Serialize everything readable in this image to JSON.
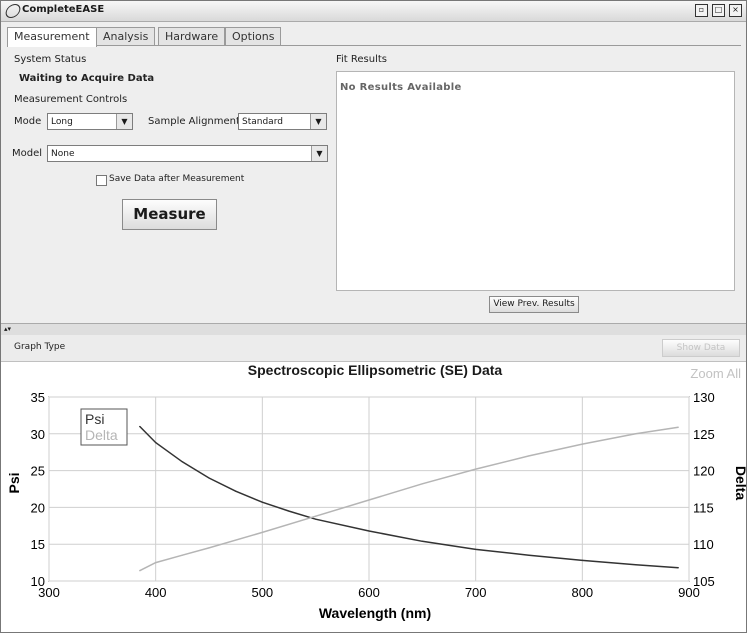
{
  "window": {
    "title": "CompleteEASE"
  },
  "tabs": [
    "Measurement",
    "Analysis",
    "Hardware",
    "Options"
  ],
  "system_status": {
    "heading": "System Status",
    "status": "Waiting to Acquire Data"
  },
  "controls": {
    "heading": "Measurement Controls",
    "mode_label": "Mode",
    "mode_value": "Long",
    "alignment_label": "Sample Alignment",
    "alignment_value": "Standard",
    "model_label": "Model",
    "model_value": "None",
    "save_label": "Save Data after Measurement",
    "measure_label": "Measure"
  },
  "fit_results": {
    "heading": "Fit Results",
    "empty": "No Results Available",
    "view_prev_label": "View Prev. Results"
  },
  "graph": {
    "type_label": "Graph Type",
    "show_data_label": "Show Data",
    "zoom_all_label": "Zoom All"
  },
  "chart_data": {
    "type": "line",
    "title": "Spectroscopic Ellipsometric (SE) Data",
    "xlabel": "Wavelength (nm)",
    "ylabel": "Psi",
    "ylabel_right": "Delta",
    "xlim": [
      300,
      900
    ],
    "ylim": [
      10,
      35
    ],
    "ylim_right": [
      105,
      130
    ],
    "xticks": [
      300,
      400,
      500,
      600,
      700,
      800,
      900
    ],
    "yticks": [
      10,
      15,
      20,
      25,
      30,
      35
    ],
    "yticks_right": [
      105,
      110,
      115,
      120,
      125,
      130
    ],
    "grid": true,
    "legend": "top-left",
    "series": [
      {
        "name": "Psi",
        "axis": "left",
        "color": "#333333",
        "x": [
          385,
          400,
          425,
          450,
          475,
          500,
          525,
          550,
          600,
          650,
          700,
          750,
          800,
          850,
          890
        ],
        "values": [
          31.0,
          28.8,
          26.2,
          24.0,
          22.2,
          20.7,
          19.5,
          18.4,
          16.8,
          15.4,
          14.3,
          13.5,
          12.8,
          12.2,
          11.8
        ]
      },
      {
        "name": "Delta",
        "axis": "right",
        "color": "#b5b5b5",
        "x": [
          385,
          400,
          425,
          450,
          500,
          550,
          600,
          650,
          700,
          750,
          800,
          850,
          890
        ],
        "values": [
          106.4,
          107.5,
          108.5,
          109.5,
          111.6,
          113.8,
          116.0,
          118.2,
          120.2,
          122.0,
          123.6,
          125.0,
          125.9
        ]
      }
    ]
  }
}
